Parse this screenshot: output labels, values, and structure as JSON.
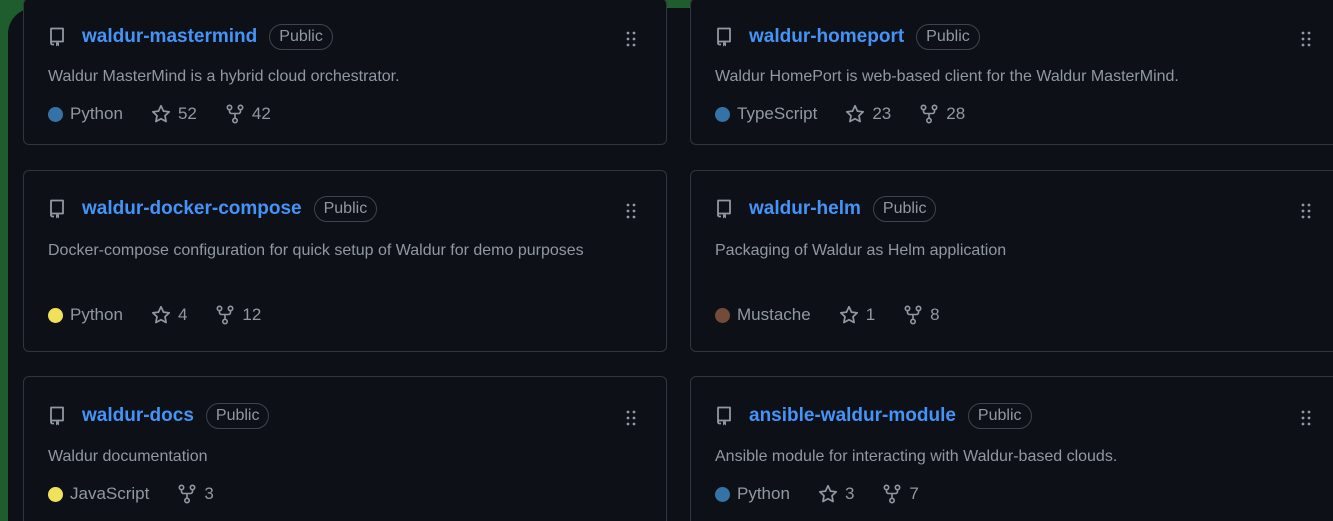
{
  "badge_label": "Public",
  "repos": [
    {
      "name": "waldur-mastermind",
      "description": "Waldur MasterMind is a hybrid cloud orchestrator.",
      "language": "Python",
      "language_color": "#3572A5",
      "stars": "52",
      "forks": "42"
    },
    {
      "name": "waldur-homeport",
      "description": "Waldur HomePort is web-based client for the Waldur MasterMind.",
      "language": "TypeScript",
      "language_color": "#3178c6",
      "stars": "23",
      "forks": "28"
    },
    {
      "name": "waldur-docker-compose",
      "description": "Docker-compose configuration for quick setup of Waldur for demo purposes",
      "language": "Python",
      "language_color": "#3572A5",
      "stars": "4",
      "forks": "12"
    },
    {
      "name": "waldur-helm",
      "description": "Packaging of Waldur as Helm application",
      "language": "Mustache",
      "language_color": "#724b3b",
      "stars": "1",
      "forks": "8"
    },
    {
      "name": "waldur-docs",
      "description": "Waldur documentation",
      "language": "JavaScript",
      "language_color": "#f1e05a",
      "forks": "3"
    },
    {
      "name": "ansible-waldur-module",
      "description": "Ansible module for interacting with Waldur-based clouds.",
      "language": "Python",
      "language_color": "#3572A5",
      "stars": "3",
      "forks": "7"
    }
  ]
}
